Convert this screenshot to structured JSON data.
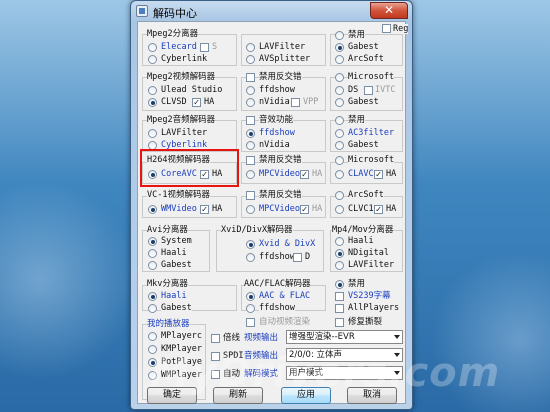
{
  "window": {
    "title": "解码中心",
    "close_glyph": "✕"
  },
  "reg_label": "Reg",
  "mpeg2_splitter": {
    "title": "Mpeg2分离器",
    "options": [
      "Elecard",
      "S",
      "Cyberlink",
      "LAVFilter",
      "AVSplitter",
      "禁用",
      "Gabest",
      "ArcSoft"
    ]
  },
  "mpeg2_video": {
    "title": "Mpeg2视频解码器",
    "options": [
      "Ulead Studio",
      "CLVSD",
      "HA",
      "禁用反交错",
      "ffdshow",
      "nVidia",
      "VPP",
      "Microsoft",
      "DS",
      "IVTC",
      "Gabest"
    ]
  },
  "mpeg2_audio": {
    "title": "Mpeg2音频解码器",
    "options": [
      "LAVFilter",
      "Cyberlink",
      "音效功能",
      "ffdshow",
      "nVidia",
      "禁用",
      "AC3filter",
      "Gabest"
    ]
  },
  "h264_video": {
    "title": "H264视频解码器",
    "options": [
      "CoreAVC",
      "HA",
      "禁用反交错",
      "MPCVideo",
      "HA",
      "Microsoft",
      "CLAVC",
      "HA"
    ]
  },
  "vc1_video": {
    "title": "VC-1视频解码器",
    "options": [
      "WMVideo",
      "HA",
      "禁用反交错",
      "MPCVideo",
      "HA",
      "ArcSoft",
      "CLVC1",
      "HA"
    ]
  },
  "avi_splitter": {
    "title": "Avi分离器",
    "options": [
      "System",
      "Haali",
      "Gabest"
    ]
  },
  "xvid": {
    "title": "XviD/DivX解码器",
    "options": [
      "Xvid & DivX",
      "ffdshow",
      "D"
    ]
  },
  "mp4": {
    "title": "Mp4/Mov分离器",
    "options": [
      "Haali",
      "NDigital",
      "LAVFilter"
    ]
  },
  "mkv": {
    "title": "Mkv分离器",
    "options": [
      "Haali",
      "Gabest"
    ]
  },
  "aac": {
    "title": "AAC/FLAC解码器",
    "options": [
      "AAC & FLAC",
      "ffdshow"
    ]
  },
  "misc": {
    "options": [
      "禁用",
      "VS239字幕",
      "AllPlayers"
    ]
  },
  "auto_render": "自动视频渲染",
  "fix_tear": "修复撕裂",
  "my_player": {
    "title": "我的播放器",
    "options": [
      "MPlayerc",
      "KMPlayer",
      "PotPlaye",
      "WMPlayer"
    ]
  },
  "bottom_options": {
    "double": "倍线",
    "spdif": "SPDIF",
    "auto": "自动",
    "video_out": "视频输出",
    "audio_out": "音频输出",
    "decode_mode": "解码模式",
    "video_out_value": "增强型渲染--EVR",
    "audio_out_value": "2/0/0: 立体声",
    "decode_mode_value": "用户模式"
  },
  "buttons": {
    "ok": "确定",
    "refresh": "刷新",
    "apply": "应用",
    "cancel": "取消"
  },
  "watermark": "MyDrivers.com",
  "colors": {
    "highlight_box": "#e8140f",
    "link_blue": "#1a3dbd"
  }
}
